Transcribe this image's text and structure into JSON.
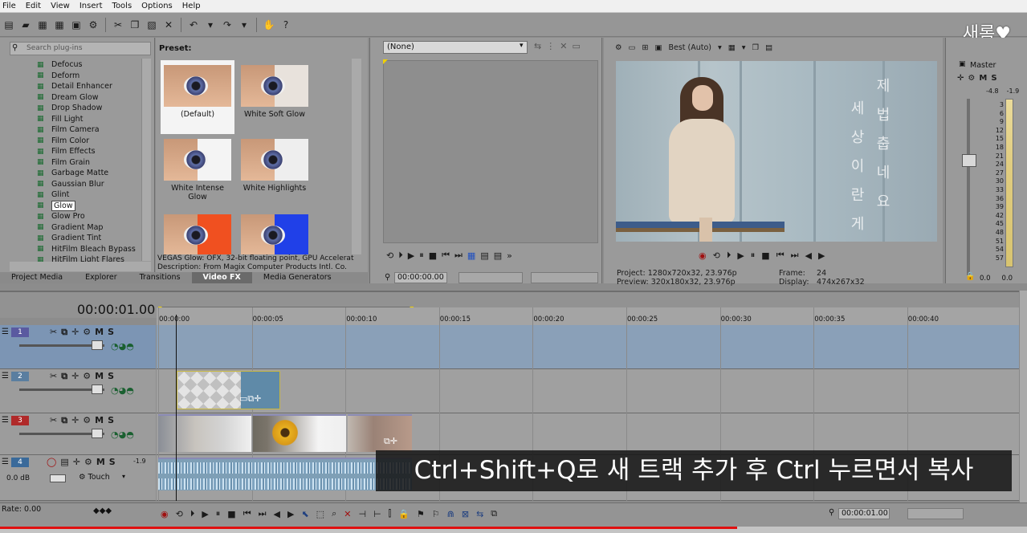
{
  "menu": [
    "File",
    "Edit",
    "View",
    "Insert",
    "Tools",
    "Options",
    "Help"
  ],
  "watermark": "새롬♥",
  "plugins": {
    "search_placeholder": "Search plug-ins",
    "items": [
      "Defocus",
      "Deform",
      "Detail Enhancer",
      "Dream Glow",
      "Drop Shadow",
      "Fill Light",
      "Film Camera",
      "Film Color",
      "Film Effects",
      "Film Grain",
      "Garbage Matte",
      "Gaussian Blur",
      "Glint",
      "Glow",
      "Glow Pro",
      "Gradient Map",
      "Gradient Tint",
      "HitFilm Bleach Bypass",
      "HitFilm Light Flares"
    ],
    "selected": "Glow"
  },
  "presets": {
    "title": "Preset:",
    "items": [
      "(Default)",
      "White Soft Glow",
      "White Intense Glow",
      "White Highlights"
    ],
    "description_line1": "VEGAS Glow: OFX, 32-bit floating point, GPU Accelerat",
    "description_line2": "Description: From Magix Computer Products Intl. Co."
  },
  "tabs": [
    "Project Media",
    "Explorer",
    "Transitions",
    "Video FX",
    "Media Generators"
  ],
  "active_tab": "Video FX",
  "trimmer": {
    "select": "(None)",
    "timecode": "00:00:00.00"
  },
  "preview": {
    "quality": "Best (Auto)",
    "project_label": "Project:",
    "project_value": "1280x720x32, 23.976p",
    "preview_label": "Preview:",
    "preview_value": "320x180x32, 23.976p",
    "frame_label": "Frame:",
    "frame_value": "24",
    "display_label": "Display:",
    "display_value": "474x267x32",
    "video_text_col1": [
      "세",
      "상",
      "이",
      "란",
      "게"
    ],
    "video_text_col2": [
      "제",
      "법",
      "춥",
      "네",
      "요"
    ]
  },
  "master": {
    "label": "Master",
    "db_left": "-4.8",
    "db_right": "-1.9",
    "scale": [
      "3",
      "6",
      "9",
      "12",
      "15",
      "18",
      "21",
      "24",
      "27",
      "30",
      "33",
      "36",
      "39",
      "42",
      "45",
      "48",
      "51",
      "54",
      "57"
    ],
    "val_left": "0.0",
    "val_right": "0.0"
  },
  "timeline": {
    "current_time": "00:00:01.00",
    "ruler": [
      "00:00:00",
      "00:00:05",
      "00:00:10",
      "00:00:15",
      "00:00:20",
      "00:00:25",
      "00:00:30",
      "00:00:35",
      "00:00:40"
    ],
    "tracks": [
      {
        "num": "1",
        "color": "#5a5aa0"
      },
      {
        "num": "2",
        "color": "#5a7ea0"
      },
      {
        "num": "3",
        "color": "#b02a2a"
      }
    ],
    "audio_track": {
      "num": "4",
      "db": "0.0 dB",
      "mode": "Touch",
      "level": "-1.9"
    },
    "rate": "Rate: 0.00",
    "bottom_timecode": "00:00:01.00"
  },
  "subtitle": "Ctrl+Shift+Q로 새 트랙 추가 후 Ctrl 누르면서 복사",
  "playback_progress": 0.718,
  "colors": {
    "accent": "#e01010",
    "selected_track": "#7c95b4",
    "audio_clip": "#7e9fb6"
  }
}
